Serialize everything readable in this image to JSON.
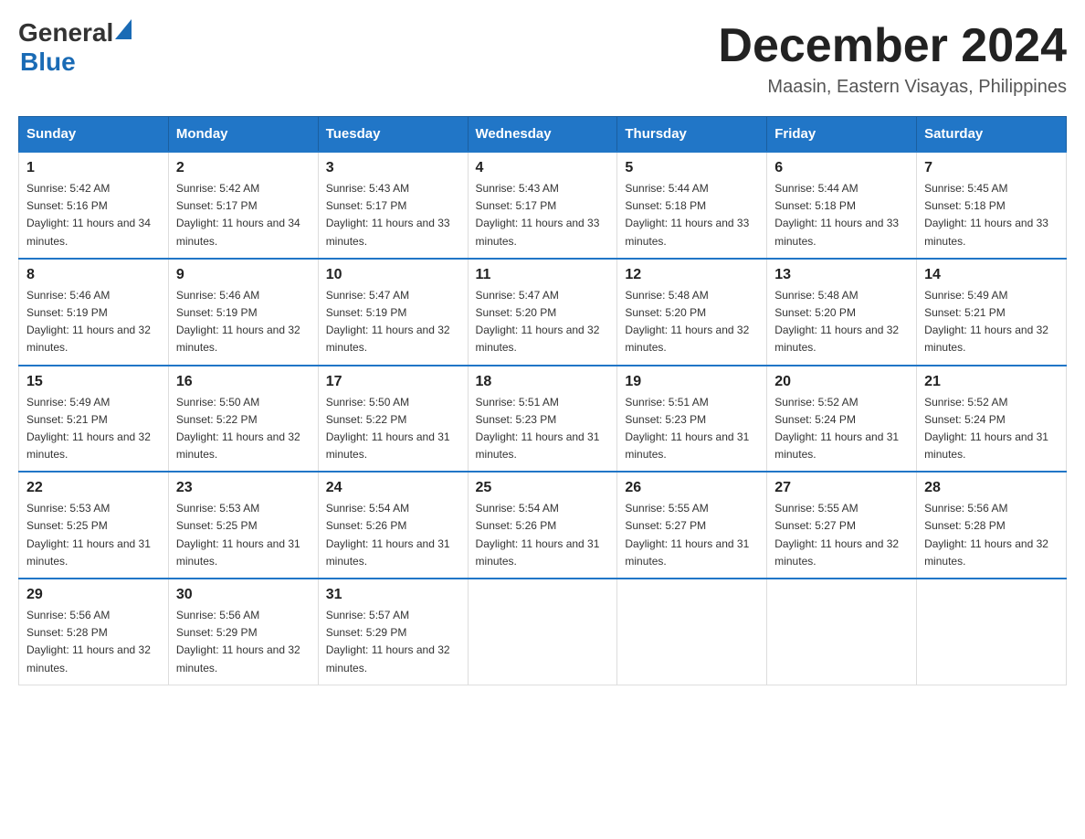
{
  "logo": {
    "general": "General",
    "blue": "Blue"
  },
  "title": "December 2024",
  "subtitle": "Maasin, Eastern Visayas, Philippines",
  "days_of_week": [
    "Sunday",
    "Monday",
    "Tuesday",
    "Wednesday",
    "Thursday",
    "Friday",
    "Saturday"
  ],
  "weeks": [
    [
      {
        "day": "1",
        "sunrise": "5:42 AM",
        "sunset": "5:16 PM",
        "daylight": "11 hours and 34 minutes."
      },
      {
        "day": "2",
        "sunrise": "5:42 AM",
        "sunset": "5:17 PM",
        "daylight": "11 hours and 34 minutes."
      },
      {
        "day": "3",
        "sunrise": "5:43 AM",
        "sunset": "5:17 PM",
        "daylight": "11 hours and 33 minutes."
      },
      {
        "day": "4",
        "sunrise": "5:43 AM",
        "sunset": "5:17 PM",
        "daylight": "11 hours and 33 minutes."
      },
      {
        "day": "5",
        "sunrise": "5:44 AM",
        "sunset": "5:18 PM",
        "daylight": "11 hours and 33 minutes."
      },
      {
        "day": "6",
        "sunrise": "5:44 AM",
        "sunset": "5:18 PM",
        "daylight": "11 hours and 33 minutes."
      },
      {
        "day": "7",
        "sunrise": "5:45 AM",
        "sunset": "5:18 PM",
        "daylight": "11 hours and 33 minutes."
      }
    ],
    [
      {
        "day": "8",
        "sunrise": "5:46 AM",
        "sunset": "5:19 PM",
        "daylight": "11 hours and 32 minutes."
      },
      {
        "day": "9",
        "sunrise": "5:46 AM",
        "sunset": "5:19 PM",
        "daylight": "11 hours and 32 minutes."
      },
      {
        "day": "10",
        "sunrise": "5:47 AM",
        "sunset": "5:19 PM",
        "daylight": "11 hours and 32 minutes."
      },
      {
        "day": "11",
        "sunrise": "5:47 AM",
        "sunset": "5:20 PM",
        "daylight": "11 hours and 32 minutes."
      },
      {
        "day": "12",
        "sunrise": "5:48 AM",
        "sunset": "5:20 PM",
        "daylight": "11 hours and 32 minutes."
      },
      {
        "day": "13",
        "sunrise": "5:48 AM",
        "sunset": "5:20 PM",
        "daylight": "11 hours and 32 minutes."
      },
      {
        "day": "14",
        "sunrise": "5:49 AM",
        "sunset": "5:21 PM",
        "daylight": "11 hours and 32 minutes."
      }
    ],
    [
      {
        "day": "15",
        "sunrise": "5:49 AM",
        "sunset": "5:21 PM",
        "daylight": "11 hours and 32 minutes."
      },
      {
        "day": "16",
        "sunrise": "5:50 AM",
        "sunset": "5:22 PM",
        "daylight": "11 hours and 32 minutes."
      },
      {
        "day": "17",
        "sunrise": "5:50 AM",
        "sunset": "5:22 PM",
        "daylight": "11 hours and 31 minutes."
      },
      {
        "day": "18",
        "sunrise": "5:51 AM",
        "sunset": "5:23 PM",
        "daylight": "11 hours and 31 minutes."
      },
      {
        "day": "19",
        "sunrise": "5:51 AM",
        "sunset": "5:23 PM",
        "daylight": "11 hours and 31 minutes."
      },
      {
        "day": "20",
        "sunrise": "5:52 AM",
        "sunset": "5:24 PM",
        "daylight": "11 hours and 31 minutes."
      },
      {
        "day": "21",
        "sunrise": "5:52 AM",
        "sunset": "5:24 PM",
        "daylight": "11 hours and 31 minutes."
      }
    ],
    [
      {
        "day": "22",
        "sunrise": "5:53 AM",
        "sunset": "5:25 PM",
        "daylight": "11 hours and 31 minutes."
      },
      {
        "day": "23",
        "sunrise": "5:53 AM",
        "sunset": "5:25 PM",
        "daylight": "11 hours and 31 minutes."
      },
      {
        "day": "24",
        "sunrise": "5:54 AM",
        "sunset": "5:26 PM",
        "daylight": "11 hours and 31 minutes."
      },
      {
        "day": "25",
        "sunrise": "5:54 AM",
        "sunset": "5:26 PM",
        "daylight": "11 hours and 31 minutes."
      },
      {
        "day": "26",
        "sunrise": "5:55 AM",
        "sunset": "5:27 PM",
        "daylight": "11 hours and 31 minutes."
      },
      {
        "day": "27",
        "sunrise": "5:55 AM",
        "sunset": "5:27 PM",
        "daylight": "11 hours and 32 minutes."
      },
      {
        "day": "28",
        "sunrise": "5:56 AM",
        "sunset": "5:28 PM",
        "daylight": "11 hours and 32 minutes."
      }
    ],
    [
      {
        "day": "29",
        "sunrise": "5:56 AM",
        "sunset": "5:28 PM",
        "daylight": "11 hours and 32 minutes."
      },
      {
        "day": "30",
        "sunrise": "5:56 AM",
        "sunset": "5:29 PM",
        "daylight": "11 hours and 32 minutes."
      },
      {
        "day": "31",
        "sunrise": "5:57 AM",
        "sunset": "5:29 PM",
        "daylight": "11 hours and 32 minutes."
      },
      null,
      null,
      null,
      null
    ]
  ],
  "labels": {
    "sunrise": "Sunrise:",
    "sunset": "Sunset:",
    "daylight": "Daylight:"
  }
}
